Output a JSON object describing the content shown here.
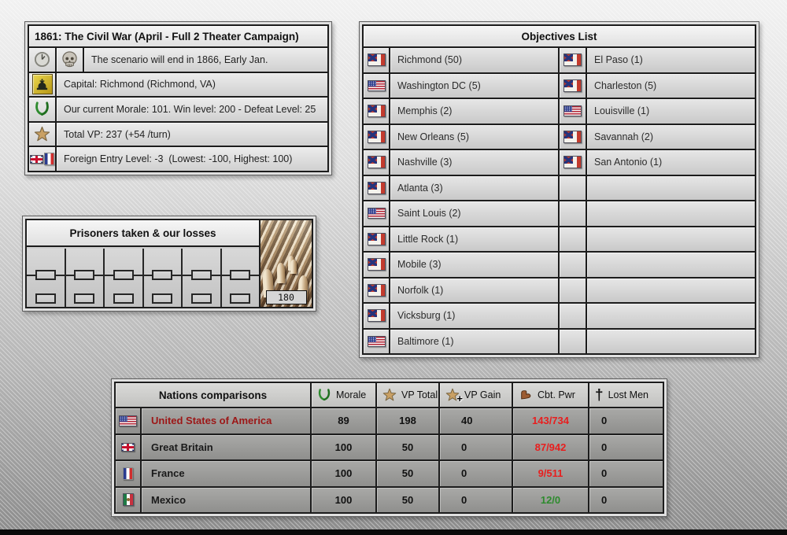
{
  "scenario_panel": {
    "title": "1861: The Civil War (April - Full 2 Theater Campaign)",
    "rows": [
      {
        "icons": [
          "clock-icon",
          "skull-icon"
        ],
        "text": "The scenario will end in 1866, Early Jan."
      },
      {
        "icons": [
          "capitol-icon"
        ],
        "text": "Capital: Richmond (Richmond, VA)"
      },
      {
        "icons": [
          "laurel-icon"
        ],
        "text": "Our current Morale: 101. Win level: 200 - Defeat Level: 25"
      },
      {
        "icons": [
          "star-icon"
        ],
        "text": "Total VP: 237 (+54 /turn)"
      },
      {
        "icons": [
          "uk-flag",
          "france-flag"
        ],
        "text": "Foreign Entry Level: -3  (Lowest: -100, Highest: 100)"
      }
    ]
  },
  "prisoners_panel": {
    "title": "Prisoners taken & our losses",
    "count_label": "180",
    "slot_columns": 6
  },
  "objectives_panel": {
    "title": "Objectives List",
    "left": [
      {
        "flag": "csa",
        "label": "Richmond (50)"
      },
      {
        "flag": "usa",
        "label": "Washington DC (5)"
      },
      {
        "flag": "csa",
        "label": "Memphis (2)"
      },
      {
        "flag": "csa",
        "label": "New Orleans (5)"
      },
      {
        "flag": "csa",
        "label": "Nashville (3)"
      },
      {
        "flag": "csa",
        "label": "Atlanta (3)"
      },
      {
        "flag": "usa",
        "label": "Saint Louis (2)"
      },
      {
        "flag": "csa",
        "label": "Little Rock (1)"
      },
      {
        "flag": "csa",
        "label": "Mobile (3)"
      },
      {
        "flag": "csa",
        "label": "Norfolk (1)"
      },
      {
        "flag": "csa",
        "label": "Vicksburg (1)"
      },
      {
        "flag": "usa",
        "label": "Baltimore (1)"
      }
    ],
    "right": [
      {
        "flag": "csa",
        "label": "El Paso (1)"
      },
      {
        "flag": "csa",
        "label": "Charleston (5)"
      },
      {
        "flag": "usa",
        "label": "Louisville (1)"
      },
      {
        "flag": "csa",
        "label": "Savannah (2)"
      },
      {
        "flag": "csa",
        "label": "San Antonio (1)"
      },
      {
        "flag": "",
        "label": ""
      },
      {
        "flag": "",
        "label": ""
      },
      {
        "flag": "",
        "label": ""
      },
      {
        "flag": "",
        "label": ""
      },
      {
        "flag": "",
        "label": ""
      },
      {
        "flag": "",
        "label": ""
      },
      {
        "flag": "",
        "label": ""
      }
    ]
  },
  "nations_panel": {
    "title": "Nations comparisons",
    "columns": [
      {
        "icon": "laurel-icon",
        "label": "Morale"
      },
      {
        "icon": "star-icon",
        "label": "VP Total"
      },
      {
        "icon": "star-plus-icon",
        "label": "VP Gain"
      },
      {
        "icon": "arm-icon",
        "label": "Cbt. Pwr"
      },
      {
        "icon": "cross-icon",
        "label": "Lost Men"
      }
    ],
    "rows": [
      {
        "flag": "usa",
        "name": "United States of America",
        "name_color": "#9c1717",
        "morale": "89",
        "vp_total": "198",
        "vp_gain": "40",
        "cbt_pwr": "143/734",
        "cbt_pwr_color": "#e81e1e",
        "lost_men": "0"
      },
      {
        "flag": "uk",
        "name": "Great Britain",
        "name_color": "#1a1a1a",
        "morale": "100",
        "vp_total": "50",
        "vp_gain": "0",
        "cbt_pwr": "87/942",
        "cbt_pwr_color": "#e81e1e",
        "lost_men": "0"
      },
      {
        "flag": "france",
        "name": "France",
        "name_color": "#1a1a1a",
        "morale": "100",
        "vp_total": "50",
        "vp_gain": "0",
        "cbt_pwr": "9/511",
        "cbt_pwr_color": "#e81e1e",
        "lost_men": "0"
      },
      {
        "flag": "mexico",
        "name": "Mexico",
        "name_color": "#1a1a1a",
        "morale": "100",
        "vp_total": "50",
        "vp_gain": "0",
        "cbt_pwr": "12/0",
        "cbt_pwr_color": "#2e8b2e",
        "lost_men": "0"
      }
    ]
  },
  "icons": {
    "plus_glyph": "+",
    "cross_glyph": "†"
  },
  "colors": {
    "loss_red": "#e81e1e",
    "gain_green": "#2e8b2e",
    "usa_maroon": "#9c1717",
    "gold_star": "#c9a064",
    "laurel_green": "#2e8b2e",
    "panel_border": "#1c1c1c"
  }
}
